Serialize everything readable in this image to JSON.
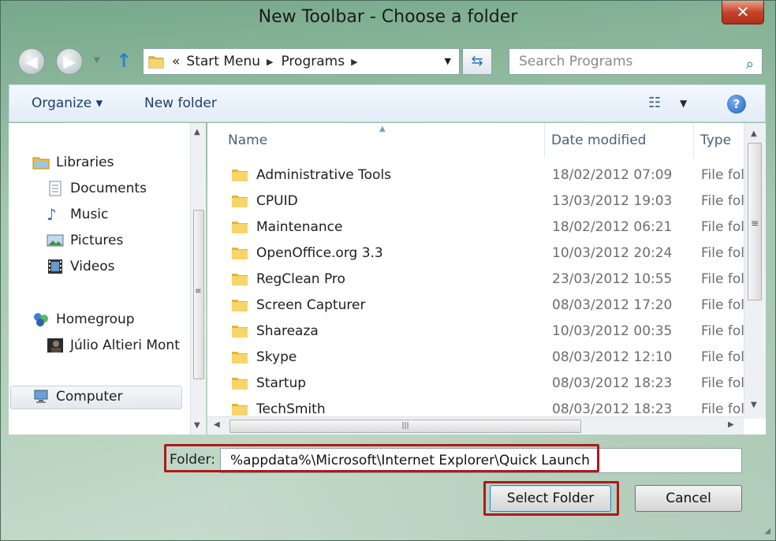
{
  "window": {
    "title": "New Toolbar - Choose a folder",
    "close_label": "✕"
  },
  "address": {
    "back_icon": "back-arrow-icon",
    "forward_icon": "forward-arrow-icon",
    "breadcrumb_overflow": "«",
    "segments": [
      "Start Menu",
      "Programs"
    ],
    "search_placeholder": "Search Programs"
  },
  "toolbar": {
    "organize_label": "Organize ▾",
    "new_folder_label": "New folder"
  },
  "nav": {
    "items": [
      {
        "label": "Libraries",
        "icon": "libraries-icon"
      },
      {
        "label": "Documents",
        "icon": "documents-icon"
      },
      {
        "label": "Music",
        "icon": "music-icon"
      },
      {
        "label": "Pictures",
        "icon": "pictures-icon"
      },
      {
        "label": "Videos",
        "icon": "videos-icon"
      },
      {
        "label": "Homegroup",
        "icon": "homegroup-icon"
      },
      {
        "label": "Júlio Altieri Mont",
        "icon": "user-avatar-icon"
      },
      {
        "label": "Computer",
        "icon": "computer-icon"
      }
    ]
  },
  "list": {
    "columns": [
      "Name",
      "Date modified",
      "Type"
    ],
    "rows": [
      {
        "name": "Administrative Tools",
        "date": "18/02/2012 07:09",
        "type": "File folder"
      },
      {
        "name": "CPUID",
        "date": "13/03/2012 19:03",
        "type": "File folder"
      },
      {
        "name": "Maintenance",
        "date": "18/02/2012 06:21",
        "type": "File folder"
      },
      {
        "name": "OpenOffice.org 3.3",
        "date": "10/03/2012 20:24",
        "type": "File folder"
      },
      {
        "name": "RegClean Pro",
        "date": "23/03/2012 10:55",
        "type": "File folder"
      },
      {
        "name": "Screen Capturer",
        "date": "08/03/2012 17:20",
        "type": "File folder"
      },
      {
        "name": "Shareaza",
        "date": "10/03/2012 00:35",
        "type": "File folder"
      },
      {
        "name": "Skype",
        "date": "08/03/2012 12:10",
        "type": "File folder"
      },
      {
        "name": "Startup",
        "date": "08/03/2012 18:23",
        "type": "File folder"
      },
      {
        "name": "TechSmith",
        "date": "08/03/2012 18:23",
        "type": "File folder"
      }
    ]
  },
  "footer": {
    "folder_label": "Folder:",
    "folder_value": "%appdata%\\Microsoft\\Internet Explorer\\Quick Launch",
    "select_label": "Select Folder",
    "cancel_label": "Cancel"
  },
  "colors": {
    "highlight": "#b01818",
    "toolbar_text": "#1e3f6e",
    "list_header": "#4c607a"
  }
}
